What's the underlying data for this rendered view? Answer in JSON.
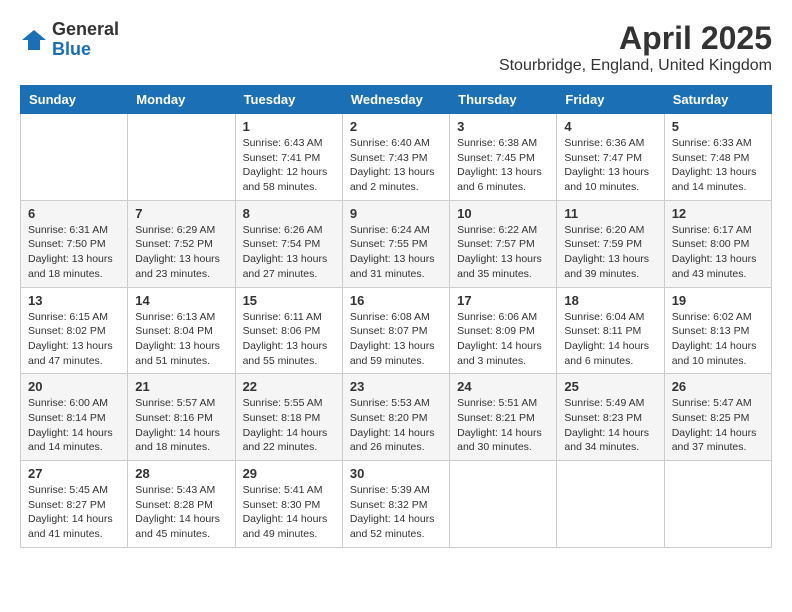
{
  "logo": {
    "general": "General",
    "blue": "Blue"
  },
  "title": "April 2025",
  "location": "Stourbridge, England, United Kingdom",
  "headers": [
    "Sunday",
    "Monday",
    "Tuesday",
    "Wednesday",
    "Thursday",
    "Friday",
    "Saturday"
  ],
  "weeks": [
    [
      {
        "day": "",
        "info": ""
      },
      {
        "day": "",
        "info": ""
      },
      {
        "day": "1",
        "info": "Sunrise: 6:43 AM\nSunset: 7:41 PM\nDaylight: 12 hours and 58 minutes."
      },
      {
        "day": "2",
        "info": "Sunrise: 6:40 AM\nSunset: 7:43 PM\nDaylight: 13 hours and 2 minutes."
      },
      {
        "day": "3",
        "info": "Sunrise: 6:38 AM\nSunset: 7:45 PM\nDaylight: 13 hours and 6 minutes."
      },
      {
        "day": "4",
        "info": "Sunrise: 6:36 AM\nSunset: 7:47 PM\nDaylight: 13 hours and 10 minutes."
      },
      {
        "day": "5",
        "info": "Sunrise: 6:33 AM\nSunset: 7:48 PM\nDaylight: 13 hours and 14 minutes."
      }
    ],
    [
      {
        "day": "6",
        "info": "Sunrise: 6:31 AM\nSunset: 7:50 PM\nDaylight: 13 hours and 18 minutes."
      },
      {
        "day": "7",
        "info": "Sunrise: 6:29 AM\nSunset: 7:52 PM\nDaylight: 13 hours and 23 minutes."
      },
      {
        "day": "8",
        "info": "Sunrise: 6:26 AM\nSunset: 7:54 PM\nDaylight: 13 hours and 27 minutes."
      },
      {
        "day": "9",
        "info": "Sunrise: 6:24 AM\nSunset: 7:55 PM\nDaylight: 13 hours and 31 minutes."
      },
      {
        "day": "10",
        "info": "Sunrise: 6:22 AM\nSunset: 7:57 PM\nDaylight: 13 hours and 35 minutes."
      },
      {
        "day": "11",
        "info": "Sunrise: 6:20 AM\nSunset: 7:59 PM\nDaylight: 13 hours and 39 minutes."
      },
      {
        "day": "12",
        "info": "Sunrise: 6:17 AM\nSunset: 8:00 PM\nDaylight: 13 hours and 43 minutes."
      }
    ],
    [
      {
        "day": "13",
        "info": "Sunrise: 6:15 AM\nSunset: 8:02 PM\nDaylight: 13 hours and 47 minutes."
      },
      {
        "day": "14",
        "info": "Sunrise: 6:13 AM\nSunset: 8:04 PM\nDaylight: 13 hours and 51 minutes."
      },
      {
        "day": "15",
        "info": "Sunrise: 6:11 AM\nSunset: 8:06 PM\nDaylight: 13 hours and 55 minutes."
      },
      {
        "day": "16",
        "info": "Sunrise: 6:08 AM\nSunset: 8:07 PM\nDaylight: 13 hours and 59 minutes."
      },
      {
        "day": "17",
        "info": "Sunrise: 6:06 AM\nSunset: 8:09 PM\nDaylight: 14 hours and 3 minutes."
      },
      {
        "day": "18",
        "info": "Sunrise: 6:04 AM\nSunset: 8:11 PM\nDaylight: 14 hours and 6 minutes."
      },
      {
        "day": "19",
        "info": "Sunrise: 6:02 AM\nSunset: 8:13 PM\nDaylight: 14 hours and 10 minutes."
      }
    ],
    [
      {
        "day": "20",
        "info": "Sunrise: 6:00 AM\nSunset: 8:14 PM\nDaylight: 14 hours and 14 minutes."
      },
      {
        "day": "21",
        "info": "Sunrise: 5:57 AM\nSunset: 8:16 PM\nDaylight: 14 hours and 18 minutes."
      },
      {
        "day": "22",
        "info": "Sunrise: 5:55 AM\nSunset: 8:18 PM\nDaylight: 14 hours and 22 minutes."
      },
      {
        "day": "23",
        "info": "Sunrise: 5:53 AM\nSunset: 8:20 PM\nDaylight: 14 hours and 26 minutes."
      },
      {
        "day": "24",
        "info": "Sunrise: 5:51 AM\nSunset: 8:21 PM\nDaylight: 14 hours and 30 minutes."
      },
      {
        "day": "25",
        "info": "Sunrise: 5:49 AM\nSunset: 8:23 PM\nDaylight: 14 hours and 34 minutes."
      },
      {
        "day": "26",
        "info": "Sunrise: 5:47 AM\nSunset: 8:25 PM\nDaylight: 14 hours and 37 minutes."
      }
    ],
    [
      {
        "day": "27",
        "info": "Sunrise: 5:45 AM\nSunset: 8:27 PM\nDaylight: 14 hours and 41 minutes."
      },
      {
        "day": "28",
        "info": "Sunrise: 5:43 AM\nSunset: 8:28 PM\nDaylight: 14 hours and 45 minutes."
      },
      {
        "day": "29",
        "info": "Sunrise: 5:41 AM\nSunset: 8:30 PM\nDaylight: 14 hours and 49 minutes."
      },
      {
        "day": "30",
        "info": "Sunrise: 5:39 AM\nSunset: 8:32 PM\nDaylight: 14 hours and 52 minutes."
      },
      {
        "day": "",
        "info": ""
      },
      {
        "day": "",
        "info": ""
      },
      {
        "day": "",
        "info": ""
      }
    ]
  ]
}
